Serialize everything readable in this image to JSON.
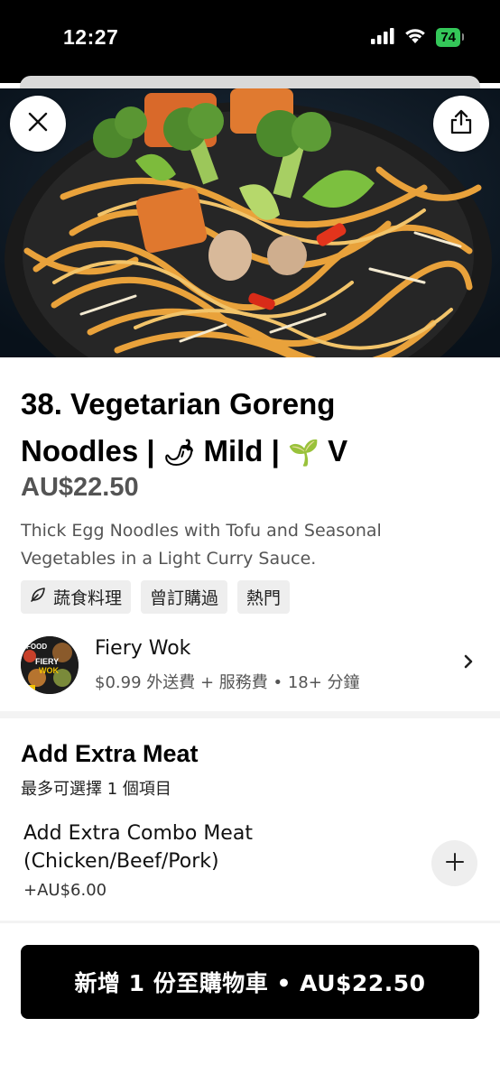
{
  "status_bar": {
    "time": "12:27",
    "battery": "74"
  },
  "item": {
    "title_line1": "38. Vegetarian Goreng",
    "title_line2_a": "Noodles | ",
    "title_chili": "🌶",
    "title_line2_b": " Mild | ",
    "title_sprout": "🌱",
    "title_line2_c": " V",
    "price": "AU$22.50",
    "description": "Thick Egg Noodles with Tofu and Seasonal Vegetables in a Light Curry Sauce.",
    "tags": [
      "蔬食料理",
      "曾訂購過",
      "熱門"
    ]
  },
  "store": {
    "name": "Fiery Wok",
    "meta": "$0.99 外送費 + 服務費 • 18+ 分鐘",
    "logo_text_1": "FOOD",
    "logo_text_2": "FIERY",
    "logo_text_3": "WOK"
  },
  "options_section": {
    "title": "Add Extra Meat",
    "subtitle": "最多可選擇 1 個項目",
    "options": [
      {
        "name_line1": "Add Extra Combo Meat",
        "name_line2": "(Chicken/Beef/Pork)",
        "price": "+AU$6.00"
      }
    ]
  },
  "cart_button": {
    "label": "新增 1 份至購物車 • AU$22.50"
  },
  "colors": {
    "accent": "#000000",
    "battery": "#34c759",
    "chip_bg": "#eeeeee"
  }
}
